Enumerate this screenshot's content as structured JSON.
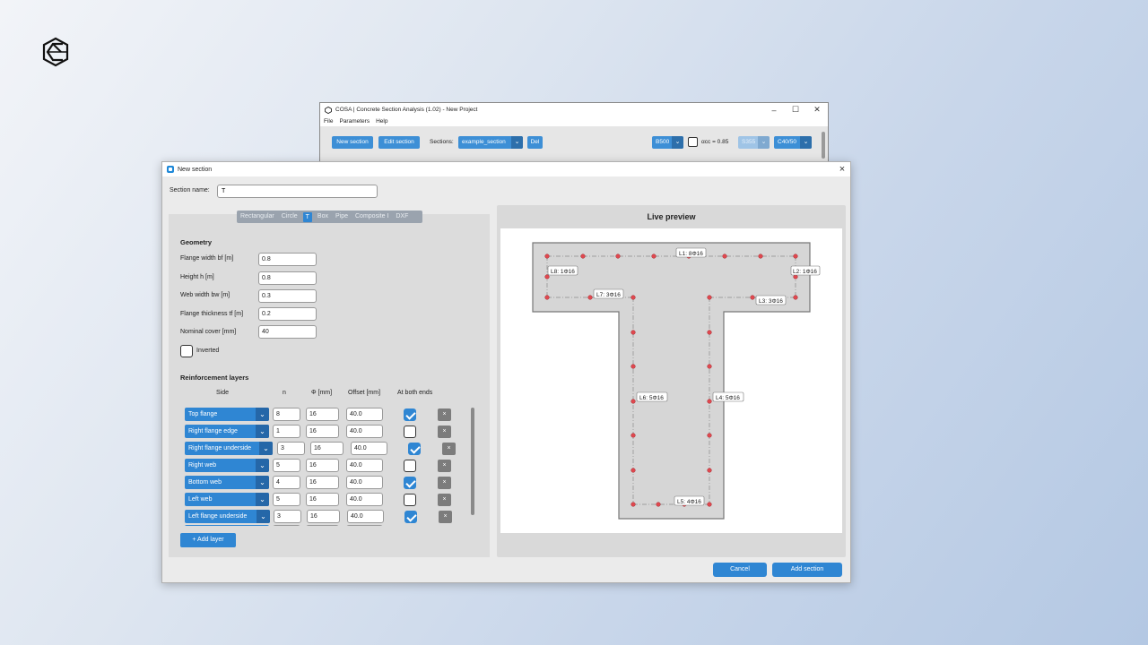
{
  "main_window": {
    "title": "COSA | Concrete Section Analysis (1.02) - New Project",
    "menu": [
      "File",
      "Parameters",
      "Help"
    ],
    "toolbar": {
      "new_section": "New section",
      "edit_section": "Edit section",
      "sections_label": "Sections:",
      "sections_value": "example_section",
      "del": "Del",
      "steel": "B500",
      "acc_label": "αcc = 0.85",
      "steel2": "S355",
      "concrete": "C40/50"
    }
  },
  "dialog": {
    "title": "New section",
    "section_name_label": "Section name:",
    "section_name_value": "T",
    "type_tabs": [
      "Rectangular",
      "Circle",
      "T",
      "Box",
      "Pipe",
      "Composite I",
      "DXF"
    ],
    "active_tab": "T",
    "geometry": {
      "title": "Geometry",
      "fields": [
        {
          "label": "Flange width bf [m]",
          "value": "0.8"
        },
        {
          "label": "Height h [m]",
          "value": "0.8"
        },
        {
          "label": "Web width bw [m]",
          "value": "0.3"
        },
        {
          "label": "Flange thickness tf [m]",
          "value": "0.2"
        },
        {
          "label": "Nominal cover [mm]",
          "value": "40"
        }
      ],
      "inverted_label": "Inverted",
      "inverted": false
    },
    "reinforcement": {
      "title": "Reinforcement layers",
      "headers": {
        "side": "Side",
        "n": "n",
        "phi": "Φ [mm]",
        "offset": "Offset [mm]",
        "both": "At both ends"
      },
      "rows": [
        {
          "side": "Top flange",
          "n": "8",
          "phi": "16",
          "offset": "40.0",
          "both": true
        },
        {
          "side": "Right flange edge",
          "n": "1",
          "phi": "16",
          "offset": "40.0",
          "both": false
        },
        {
          "side": "Right flange underside",
          "n": "3",
          "phi": "16",
          "offset": "40.0",
          "both": true
        },
        {
          "side": "Right web",
          "n": "5",
          "phi": "16",
          "offset": "40.0",
          "both": false
        },
        {
          "side": "Bottom web",
          "n": "4",
          "phi": "16",
          "offset": "40.0",
          "both": true
        },
        {
          "side": "Left web",
          "n": "5",
          "phi": "16",
          "offset": "40.0",
          "both": false
        },
        {
          "side": "Left flange underside",
          "n": "3",
          "phi": "16",
          "offset": "40.0",
          "both": true
        }
      ],
      "delete_glyph": "×",
      "add_layer": "+ Add layer"
    },
    "preview": {
      "title": "Live preview",
      "layer_labels": [
        "L1: 8Φ16",
        "L2: 1Φ16",
        "L3: 3Φ16",
        "L4: 5Φ16",
        "L5: 4Φ16",
        "L6: 5Φ16",
        "L7: 3Φ16",
        "L8: 1Φ16"
      ]
    },
    "buttons": {
      "cancel": "Cancel",
      "add": "Add section"
    }
  },
  "colors": {
    "accent": "#2f86d3",
    "accent_dark": "#2567a8",
    "rebar": "#e0484f"
  }
}
